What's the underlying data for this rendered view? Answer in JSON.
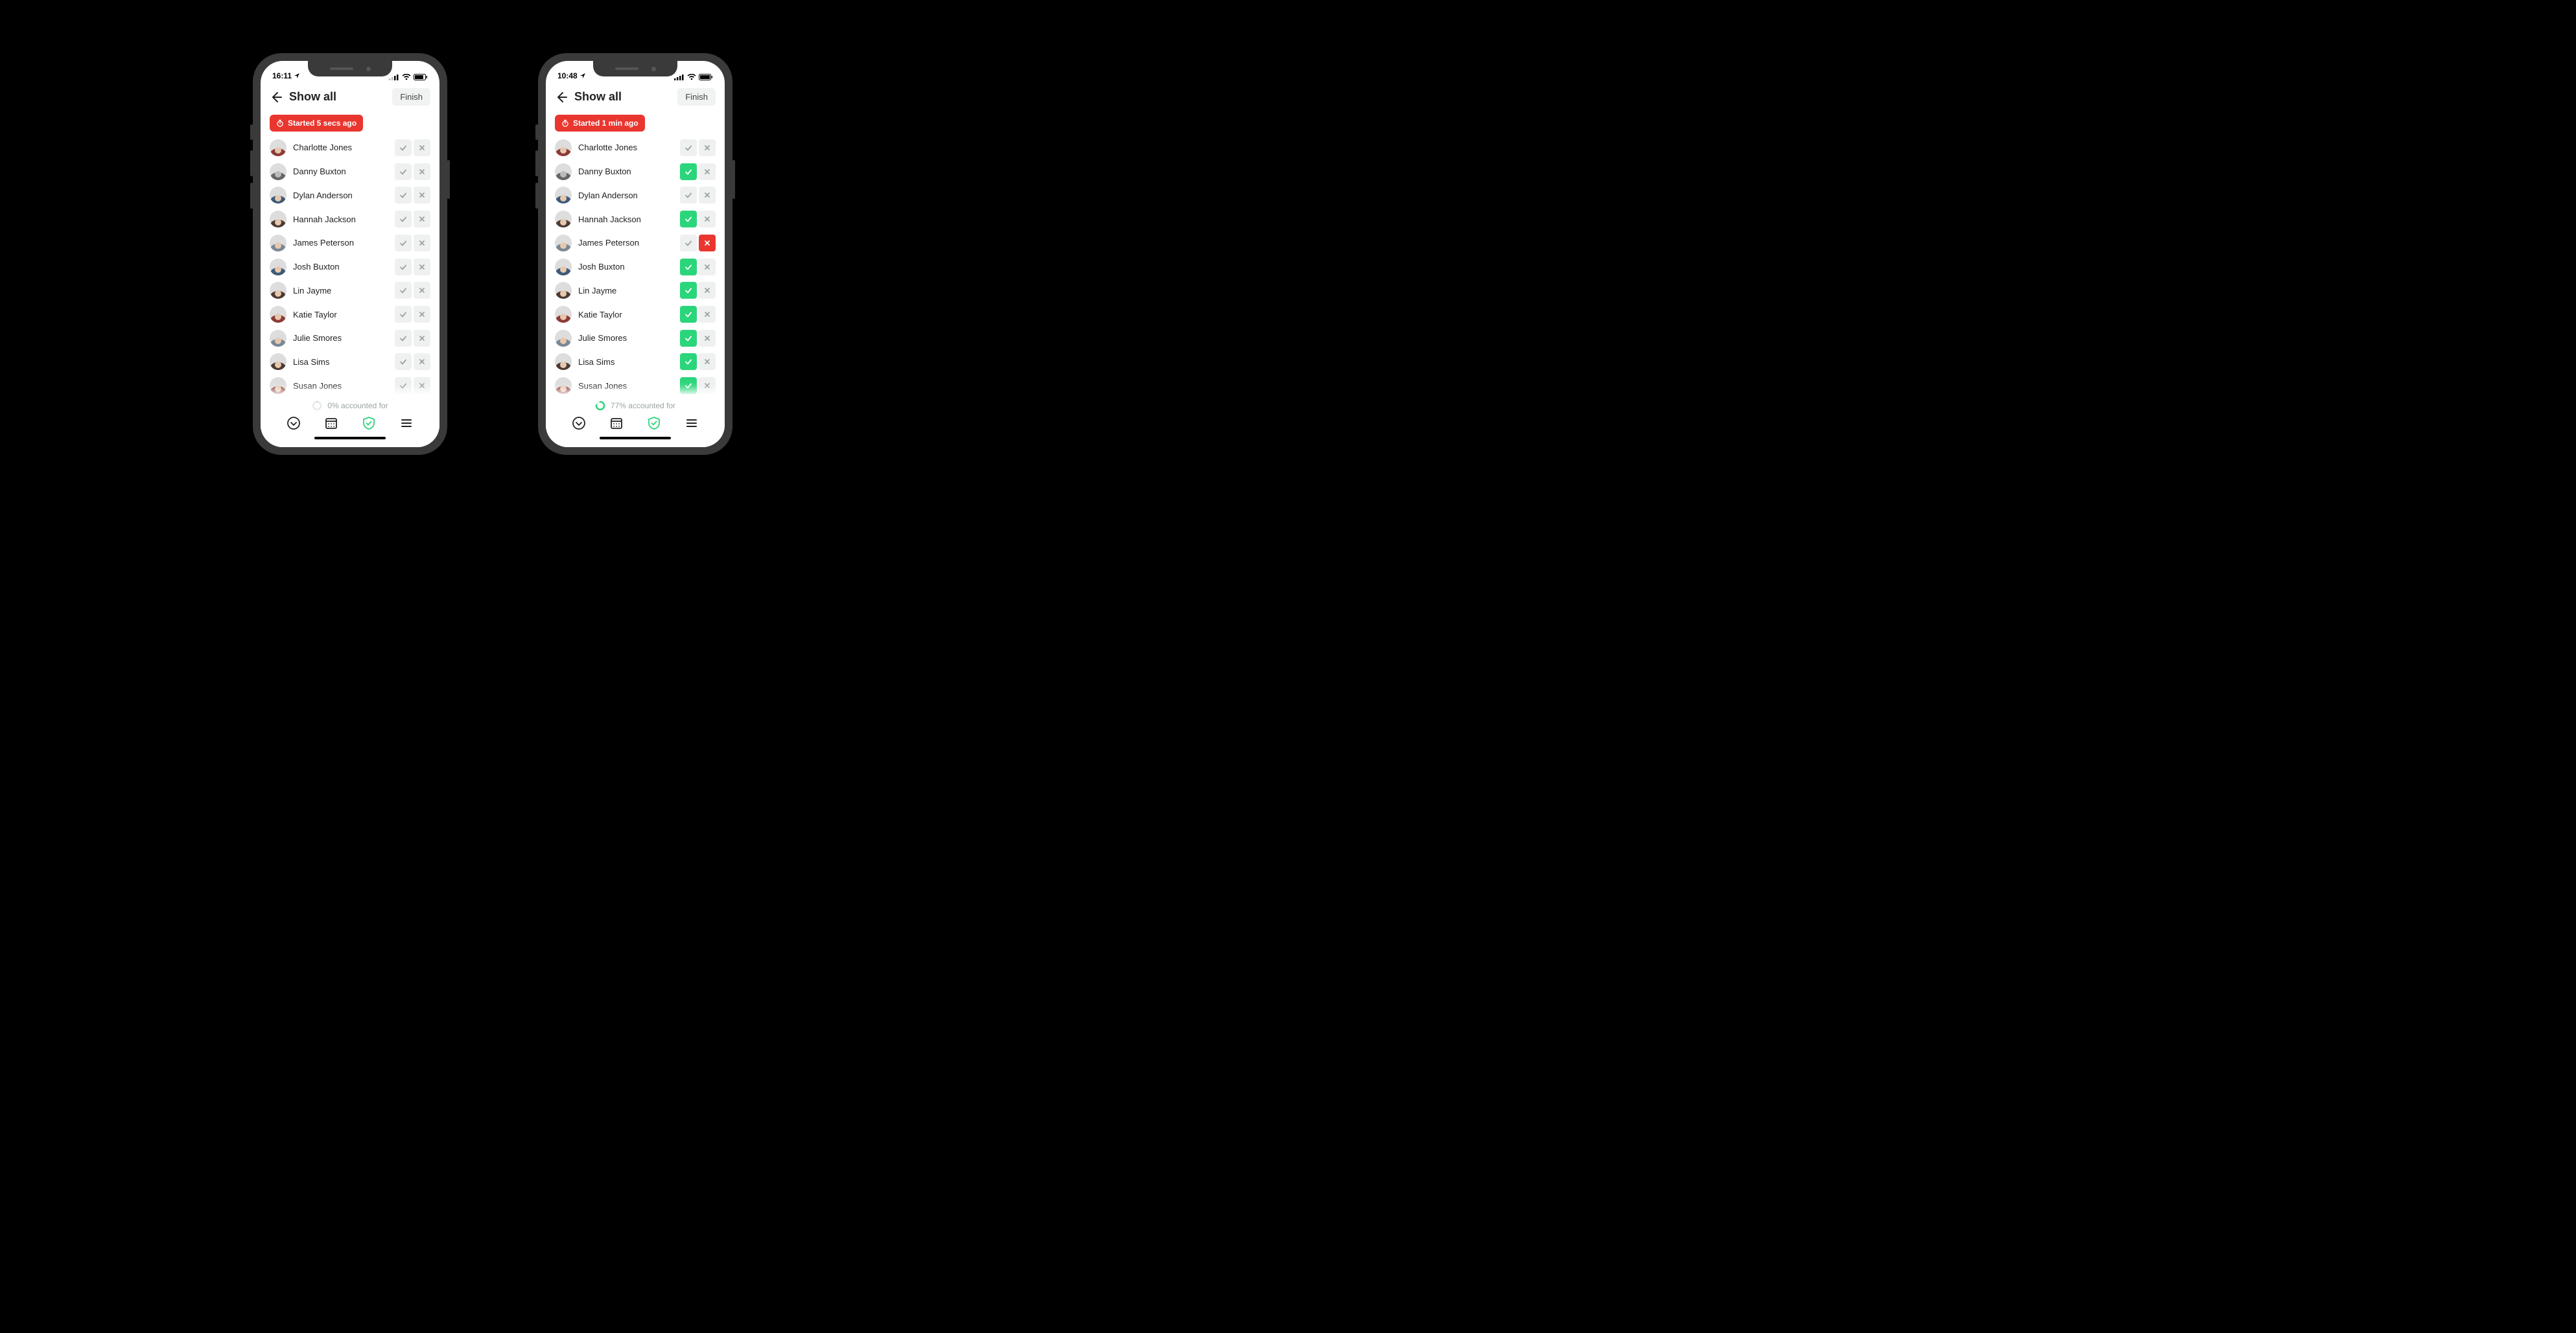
{
  "left": {
    "status_time": "16:11",
    "header_title": "Show all",
    "finish_label": "Finish",
    "banner_label": "Started 5 secs ago",
    "progress_label": "0% accounted for",
    "progress_pct": 0,
    "people": [
      {
        "name": "Charlotte Jones",
        "check": false,
        "cross": false,
        "avatar": "red"
      },
      {
        "name": "Danny Buxton",
        "check": false,
        "cross": false,
        "avatar": "bw"
      },
      {
        "name": "Dylan Anderson",
        "check": false,
        "cross": false,
        "avatar": "blue"
      },
      {
        "name": "Hannah Jackson",
        "check": false,
        "cross": false,
        "avatar": "dark"
      },
      {
        "name": "James Peterson",
        "check": false,
        "cross": false,
        "avatar": ""
      },
      {
        "name": "Josh Buxton",
        "check": false,
        "cross": false,
        "avatar": "blue"
      },
      {
        "name": "Lin Jayme",
        "check": false,
        "cross": false,
        "avatar": "dark"
      },
      {
        "name": "Katie Taylor",
        "check": false,
        "cross": false,
        "avatar": "red"
      },
      {
        "name": "Julie Smores",
        "check": false,
        "cross": false,
        "avatar": ""
      },
      {
        "name": "Lisa Sims",
        "check": false,
        "cross": false,
        "avatar": "dark"
      },
      {
        "name": "Susan Jones",
        "check": false,
        "cross": false,
        "avatar": "red"
      }
    ]
  },
  "right": {
    "status_time": "10:48",
    "header_title": "Show all",
    "finish_label": "Finish",
    "banner_label": "Started 1 min ago",
    "progress_label": "77% accounted for",
    "progress_pct": 77,
    "people": [
      {
        "name": "Charlotte Jones",
        "check": false,
        "cross": false,
        "avatar": "red"
      },
      {
        "name": "Danny Buxton",
        "check": true,
        "cross": false,
        "avatar": "bw"
      },
      {
        "name": "Dylan Anderson",
        "check": false,
        "cross": false,
        "avatar": "blue"
      },
      {
        "name": "Hannah Jackson",
        "check": true,
        "cross": false,
        "avatar": "dark"
      },
      {
        "name": "James Peterson",
        "check": false,
        "cross": true,
        "avatar": ""
      },
      {
        "name": "Josh Buxton",
        "check": true,
        "cross": false,
        "avatar": "blue"
      },
      {
        "name": "Lin Jayme",
        "check": true,
        "cross": false,
        "avatar": "dark"
      },
      {
        "name": "Katie Taylor",
        "check": true,
        "cross": false,
        "avatar": "red"
      },
      {
        "name": "Julie Smores",
        "check": true,
        "cross": false,
        "avatar": ""
      },
      {
        "name": "Lisa Sims",
        "check": true,
        "cross": false,
        "avatar": "dark"
      },
      {
        "name": "Susan Jones",
        "check": true,
        "cross": false,
        "avatar": "red"
      }
    ]
  },
  "tabs": {
    "active": "shield"
  },
  "colors": {
    "accent_green": "#2bd67b",
    "accent_red": "#e9362f",
    "muted": "#9aa3a1"
  }
}
